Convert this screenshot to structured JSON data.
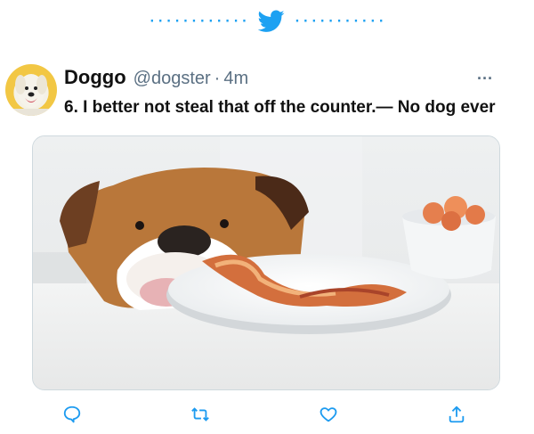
{
  "header_decoration": {
    "dots_left": "············",
    "dots_right": "···········"
  },
  "tweet": {
    "display_name": "Doggo",
    "handle": "@dogster",
    "separator": "·",
    "time": "4m",
    "more_label": "···",
    "text": "6. I better not steal that off the counter.— No dog ever"
  },
  "icons": {
    "brand": "twitter-bird-icon",
    "reply": "reply-icon",
    "retweet": "retweet-icon",
    "like": "heart-icon",
    "share": "share-icon"
  },
  "colors": {
    "brand_blue": "#1da1f2",
    "action_blue": "#1d9bf0",
    "muted": "#5b7083"
  }
}
